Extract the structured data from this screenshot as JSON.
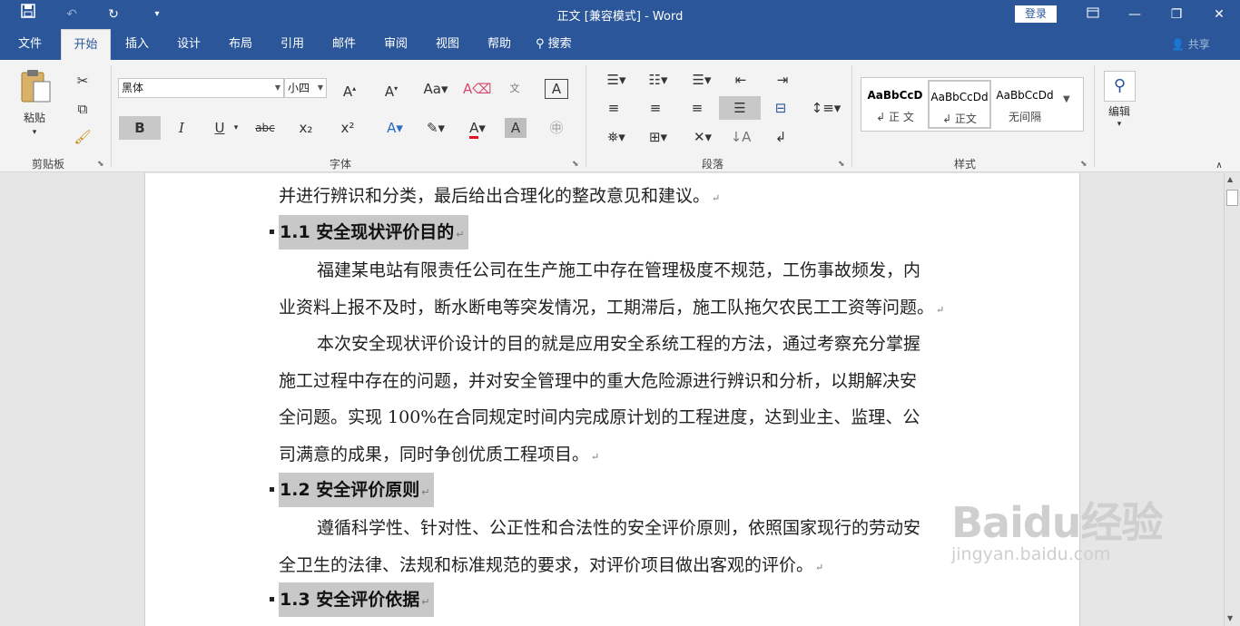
{
  "app": {
    "title": "正文 [兼容模式]  -  Word",
    "login_label": "登录"
  },
  "quick_access": {
    "save_icon": "floppy-disk",
    "undo_icon": "undo-arrow",
    "redo_icon": "redo-arrow",
    "customize_icon": "dropdown-caret"
  },
  "tabs": [
    {
      "label": "文件"
    },
    {
      "label": "开始"
    },
    {
      "label": "插入"
    },
    {
      "label": "设计"
    },
    {
      "label": "布局"
    },
    {
      "label": "引用"
    },
    {
      "label": "邮件"
    },
    {
      "label": "审阅"
    },
    {
      "label": "视图"
    },
    {
      "label": "帮助"
    },
    {
      "label": "搜索"
    }
  ],
  "share_label": "共享",
  "ribbon": {
    "clipboard": {
      "paste_label": "粘贴",
      "group_label": "剪贴板"
    },
    "font": {
      "font_name": "黑体",
      "font_size": "小四",
      "bold": "B",
      "italic": "I",
      "underline": "U",
      "strike": "abc",
      "subscript": "x₂",
      "superscript": "x²",
      "group_label": "字体"
    },
    "paragraph": {
      "group_label": "段落"
    },
    "styles": {
      "items": [
        {
          "sample": "AaBbCcD",
          "name": "↲ 正 文"
        },
        {
          "sample": "AaBbCcDd",
          "name": "↲ 正文"
        },
        {
          "sample": "AaBbCcDd",
          "name": "无间隔"
        }
      ],
      "group_label": "样式"
    },
    "editing": {
      "label": "编辑"
    }
  },
  "document": {
    "lines": [
      {
        "text": "并进行辨识和分类，最后给出合理化的整改意见和建议。",
        "type": "body"
      },
      {
        "text": "1.1 安全现状评价目的",
        "type": "heading"
      },
      {
        "text": "福建某电站有限责任公司在生产施工中存在管理极度不规范，工伤事故频发，内",
        "type": "first"
      },
      {
        "text": "业资料上报不及时，断水断电等突发情况，工期滞后，施工队拖欠农民工工资等问题。",
        "type": "body"
      },
      {
        "text": "本次安全现状评价设计的目的就是应用安全系统工程的方法，通过考察充分掌握",
        "type": "first"
      },
      {
        "text": "施工过程中存在的问题，并对安全管理中的重大危险源进行辨识和分析，以期解决安",
        "type": "body"
      },
      {
        "text": "全问题。实现 100%在合同规定时间内完成原计划的工程进度，达到业主、监理、公",
        "type": "body"
      },
      {
        "text": "司满意的成果，同时争创优质工程项目。",
        "type": "body"
      },
      {
        "text": "1.2 安全评价原则",
        "type": "heading"
      },
      {
        "text": "遵循科学性、针对性、公正性和合法性的安全评价原则，依照国家现行的劳动安",
        "type": "first"
      },
      {
        "text": "全卫生的法律、法规和标准规范的要求，对评价项目做出客观的评价。",
        "type": "body"
      },
      {
        "text": "1.3 安全评价依据",
        "type": "heading"
      }
    ],
    "paragraph_mark": "↵"
  },
  "watermark": {
    "brand": "Baidu经验",
    "url": "jingyan.baidu.com"
  }
}
